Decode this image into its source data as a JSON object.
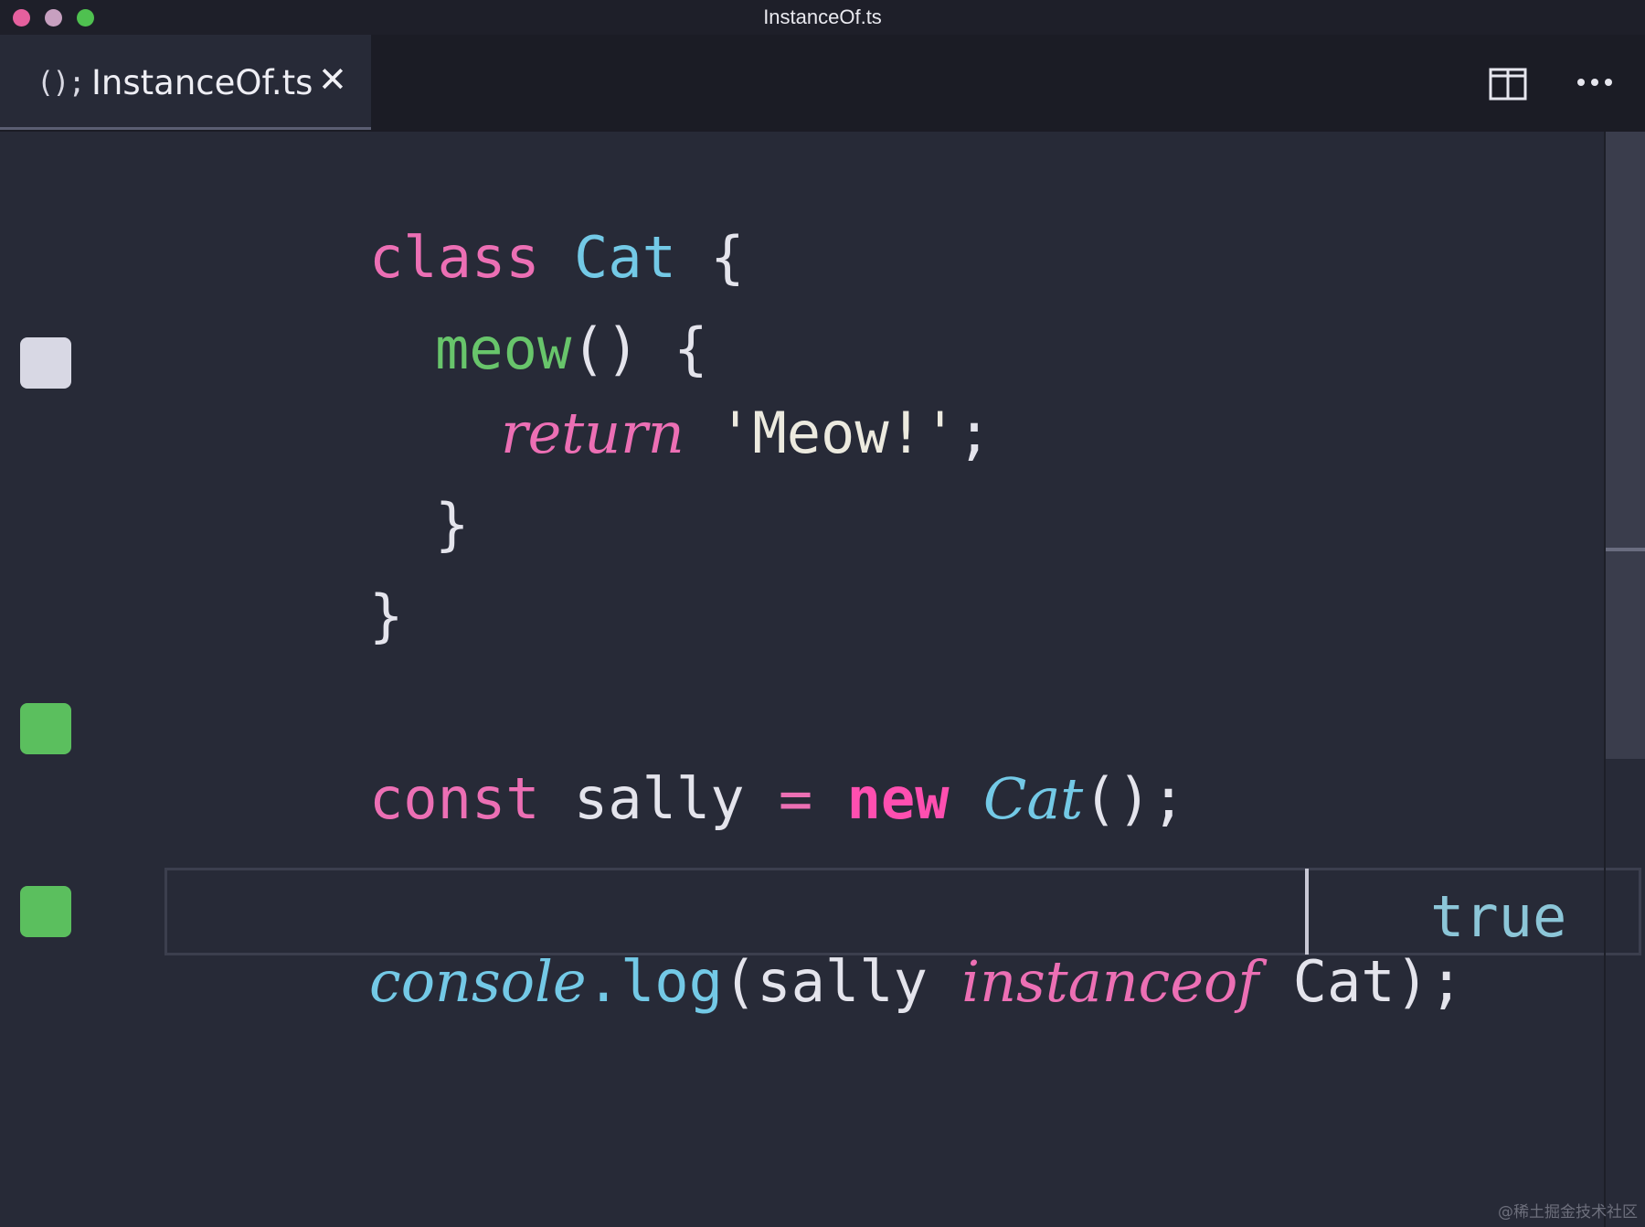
{
  "window": {
    "title": "InstanceOf.ts"
  },
  "tabs": [
    {
      "icon": "(); ",
      "label": "InstanceOf.ts",
      "close": "✕"
    }
  ],
  "toolbar": {
    "split_icon": "split-editor-icon",
    "more_icon": "more-actions-icon"
  },
  "code": {
    "line1": {
      "t1": "class",
      "t2": " ",
      "t3": "Cat",
      "t4": " {"
    },
    "line2": {
      "t1": "meow",
      "t2": "() {"
    },
    "line3": {
      "t1": "return",
      "t2": " ",
      "t3": "'Meow!'",
      "t4": ";"
    },
    "line4": {
      "t1": "}"
    },
    "line5": {
      "t1": "}"
    },
    "line7": {
      "t1": "const",
      "t2": " sally ",
      "t3": "=",
      "t4": " ",
      "t5": "new",
      "t6": " ",
      "t7": "Cat",
      "t8": "();"
    },
    "line9": {
      "t1": "console",
      "t2": ".log",
      "t3": "(sally ",
      "t4": "instanceof",
      "t5": " Cat);"
    }
  },
  "result": {
    "value": "true"
  },
  "indicators": [
    {
      "line": 3,
      "status": "gray"
    },
    {
      "line": 7,
      "status": "green"
    },
    {
      "line": 9,
      "status": "green"
    }
  ],
  "colors": {
    "background": "#272a37",
    "keyword": "#ec6fb4",
    "class_name": "#73c9e6",
    "function": "#68c56b",
    "indicator_ok": "#5bbf5e",
    "indicator_pending": "#d8d8e4"
  },
  "watermark": "@稀土掘金技术社区"
}
